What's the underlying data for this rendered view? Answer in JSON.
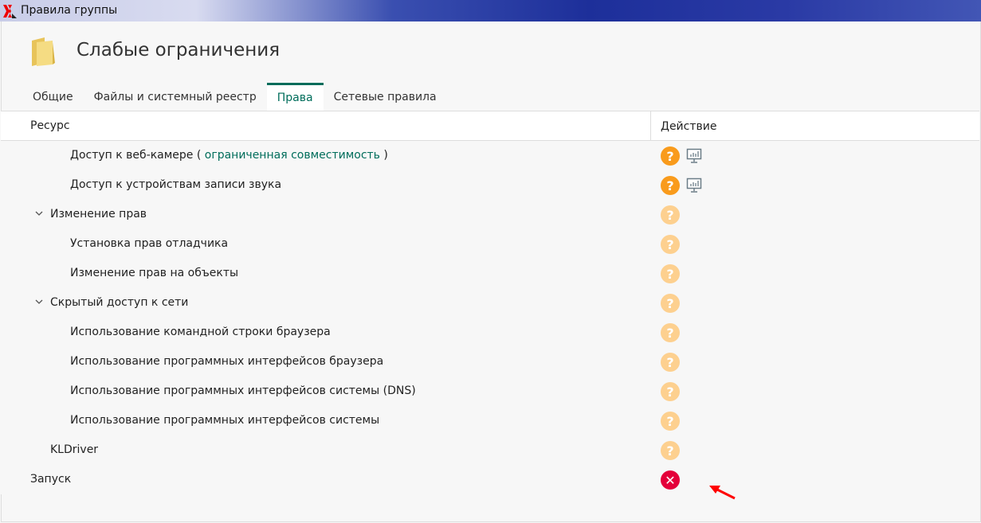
{
  "window": {
    "title": "Правила группы"
  },
  "page": {
    "title": "Слабые ограничения"
  },
  "tabs": [
    {
      "label": "Общие"
    },
    {
      "label": "Файлы и системный реестр"
    },
    {
      "label": "Права",
      "active": true
    },
    {
      "label": "Сетевые правила"
    }
  ],
  "table": {
    "col_resource": "Ресурс",
    "col_action": "Действие",
    "rows": [
      {
        "label": "Доступ к веб-камере (",
        "link": "ограниченная совместимость",
        "suffix": ")",
        "level": 2,
        "action": "ask",
        "monitor": true
      },
      {
        "label": "Доступ к устройствам записи звука",
        "level": 2,
        "action": "ask",
        "monitor": true
      },
      {
        "label": "Изменение прав",
        "level": 1,
        "expanded": true,
        "action": "ask-inherited"
      },
      {
        "label": "Установка прав отладчика",
        "level": 2,
        "action": "ask-inherited"
      },
      {
        "label": "Изменение прав на объекты",
        "level": 2,
        "action": "ask-inherited"
      },
      {
        "label": "Скрытый доступ к сети",
        "level": 1,
        "expanded": true,
        "action": "ask-inherited"
      },
      {
        "label": "Использование командной строки браузера",
        "level": 2,
        "action": "ask-inherited"
      },
      {
        "label": "Использование программных интерфейсов браузера",
        "level": 2,
        "action": "ask-inherited"
      },
      {
        "label": "Использование программных интерфейсов системы (DNS)",
        "level": 2,
        "action": "ask-inherited"
      },
      {
        "label": "Использование программных интерфейсов системы",
        "level": 2,
        "action": "ask-inherited"
      },
      {
        "label": "KLDriver",
        "level": 1,
        "action": "ask-inherited"
      },
      {
        "label": "Запуск",
        "level": 0,
        "action": "deny"
      }
    ]
  },
  "colors": {
    "accent": "#006d5b",
    "ask": "#f99b1c",
    "deny": "#e4003a"
  }
}
